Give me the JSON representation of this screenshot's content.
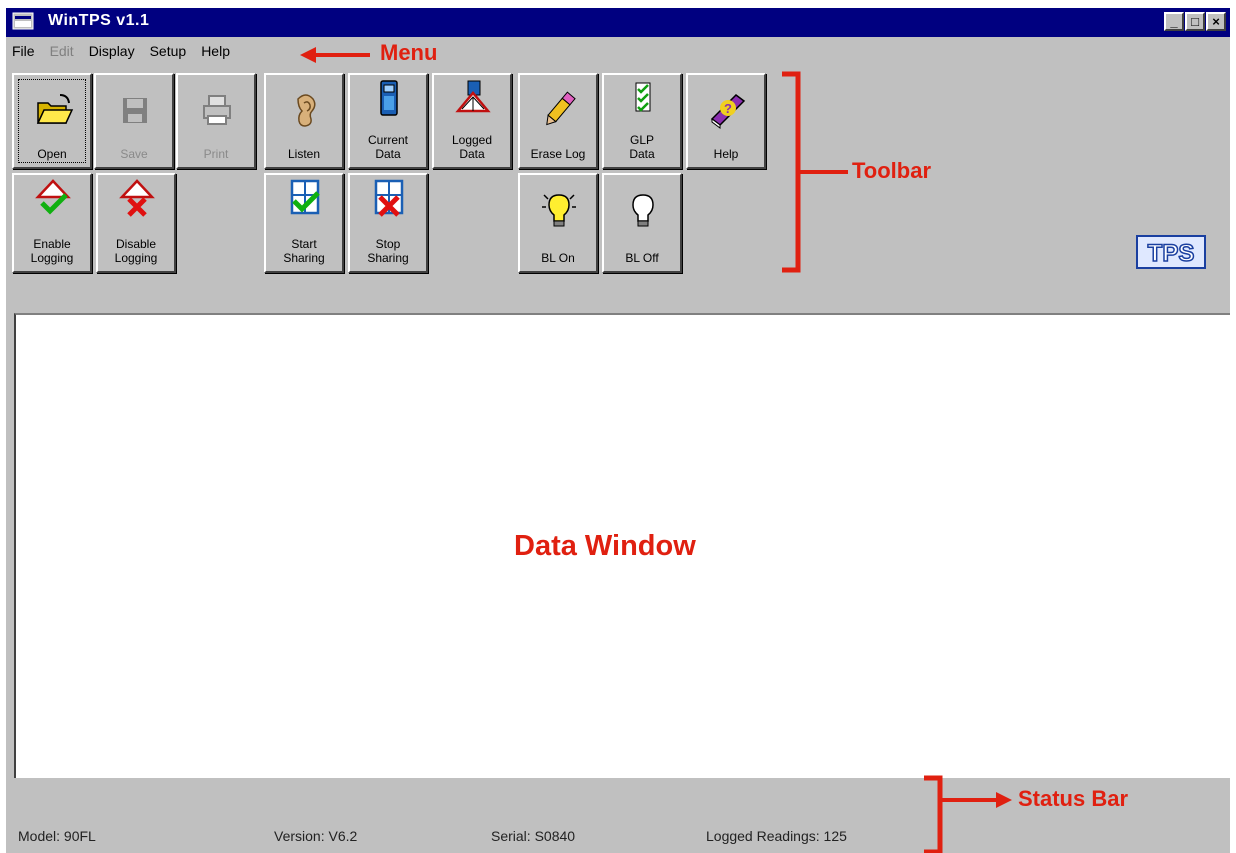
{
  "window": {
    "title": "WinTPS v1.1",
    "buttons": [
      "_",
      "□",
      "×"
    ]
  },
  "menu": [
    "File",
    "Edit",
    "Display",
    "Setup",
    "Help"
  ],
  "menu_disabled": [
    false,
    true,
    false,
    false,
    false
  ],
  "toolbar": {
    "row1": [
      {
        "label": "Open",
        "icon": "open-folder-icon"
      },
      {
        "label": "Save",
        "icon": "floppy-disk-icon"
      },
      {
        "label": "Print",
        "icon": "printer-icon"
      },
      {
        "label": "Listen",
        "icon": "ear-icon"
      },
      {
        "label": "Current\nData",
        "icon": "handheld-meter-icon"
      },
      {
        "label": "Logged\nData",
        "icon": "logged-data-book-icon"
      },
      {
        "label": "Erase Log",
        "icon": "eraser-pencil-icon"
      },
      {
        "label": "GLP\nData",
        "icon": "checklist-icon"
      },
      {
        "label": "Help",
        "icon": "help-book-icon"
      }
    ],
    "row2": [
      {
        "label": "Enable\nLogging",
        "icon": "enable-logging-icon"
      },
      {
        "label": "Disable\nLogging",
        "icon": "disable-logging-icon"
      },
      {
        "label": "Start\nSharing",
        "icon": "start-sharing-icon"
      },
      {
        "label": "Stop\nSharing",
        "icon": "stop-sharing-icon"
      },
      {
        "label": "BL On",
        "icon": "bulb-on-icon"
      },
      {
        "label": "BL Off",
        "icon": "bulb-off-icon"
      }
    ]
  },
  "logo_text": "TPS",
  "status": {
    "model": "Model: 90FL",
    "version": "Version: V6.2",
    "serial": "Serial: S0840",
    "logged": "Logged Readings: 125"
  },
  "annotations": {
    "menu": "Menu",
    "toolbar": "Toolbar",
    "data_window": "Data Window",
    "status_bar": "Status Bar"
  },
  "colors": {
    "title_bar": "#000080",
    "face": "#c0c0c0",
    "annotation": "#e02010"
  }
}
